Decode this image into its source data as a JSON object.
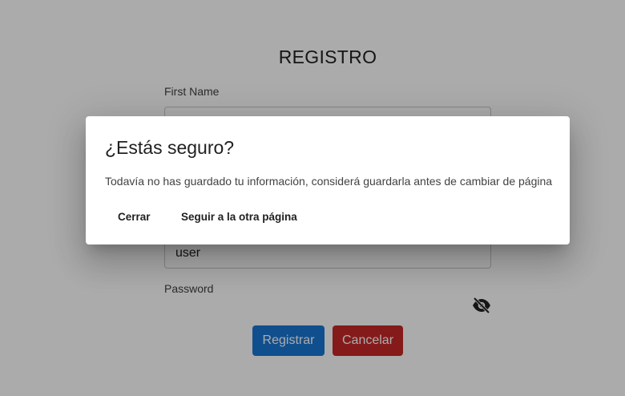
{
  "form": {
    "title": "REGISTRO",
    "first_name_label": "First Name",
    "first_name_value": "",
    "username_value": "user",
    "password_label": "Password",
    "register_label": "Registrar",
    "cancel_label": "Cancelar"
  },
  "dialog": {
    "title": "¿Estás seguro?",
    "message": "Todavía no has guardado tu información, considerá guardarla antes de cambiar de página",
    "close_label": "Cerrar",
    "continue_label": "Seguir a la otra página"
  },
  "icons": {
    "password_toggle": "eye-off-icon"
  },
  "colors": {
    "primary": "#1976d2",
    "danger": "#c62828",
    "overlay": "rgba(0,0,0,0.33)"
  }
}
